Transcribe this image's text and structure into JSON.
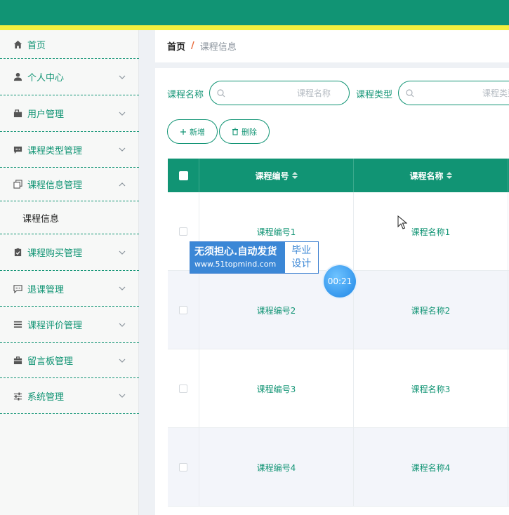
{
  "sidebar": {
    "items": [
      {
        "label": "首页",
        "icon": "home-icon",
        "has_chevron": false
      },
      {
        "label": "个人中心",
        "icon": "user-icon",
        "has_chevron": true
      },
      {
        "label": "用户管理",
        "icon": "folder-icon",
        "has_chevron": true
      },
      {
        "label": "课程类型管理",
        "icon": "chat-icon",
        "has_chevron": true
      },
      {
        "label": "课程信息管理",
        "icon": "copy-icon",
        "has_chevron": true,
        "expanded": true
      },
      {
        "label": "课程购买管理",
        "icon": "clipboard-icon",
        "has_chevron": true
      },
      {
        "label": "退课管理",
        "icon": "message-icon",
        "has_chevron": true
      },
      {
        "label": "课程评价管理",
        "icon": "list-icon",
        "has_chevron": true
      },
      {
        "label": "留言板管理",
        "icon": "briefcase-icon",
        "has_chevron": true
      },
      {
        "label": "系统管理",
        "icon": "sliders-icon",
        "has_chevron": true
      }
    ],
    "submenu": {
      "label": "课程信息"
    }
  },
  "breadcrumb": {
    "home": "首页",
    "separator": "/",
    "current": "课程信息"
  },
  "search": {
    "name_label": "课程名称",
    "name_placeholder": "课程名称",
    "type_label": "课程类型",
    "type_placeholder": "课程类型"
  },
  "toolbar": {
    "add_label": "新增",
    "delete_label": "删除"
  },
  "table": {
    "columns": [
      "课程编号",
      "课程名称"
    ],
    "rows": [
      {
        "code": "课程编号1",
        "name": "课程名称1"
      },
      {
        "code": "课程编号2",
        "name": "课程名称2"
      },
      {
        "code": "课程编号3",
        "name": "课程名称3"
      },
      {
        "code": "课程编号4",
        "name": "课程名称4"
      }
    ]
  },
  "watermark": {
    "line1": "无须担心.自动发货",
    "line2": "www.51topmind.com",
    "right1": "毕业",
    "right2": "设计"
  },
  "timer": {
    "text": "00:21"
  },
  "colors": {
    "primary": "#119474",
    "stripe": "#f3ef3f",
    "accent": "#e86a3a"
  }
}
